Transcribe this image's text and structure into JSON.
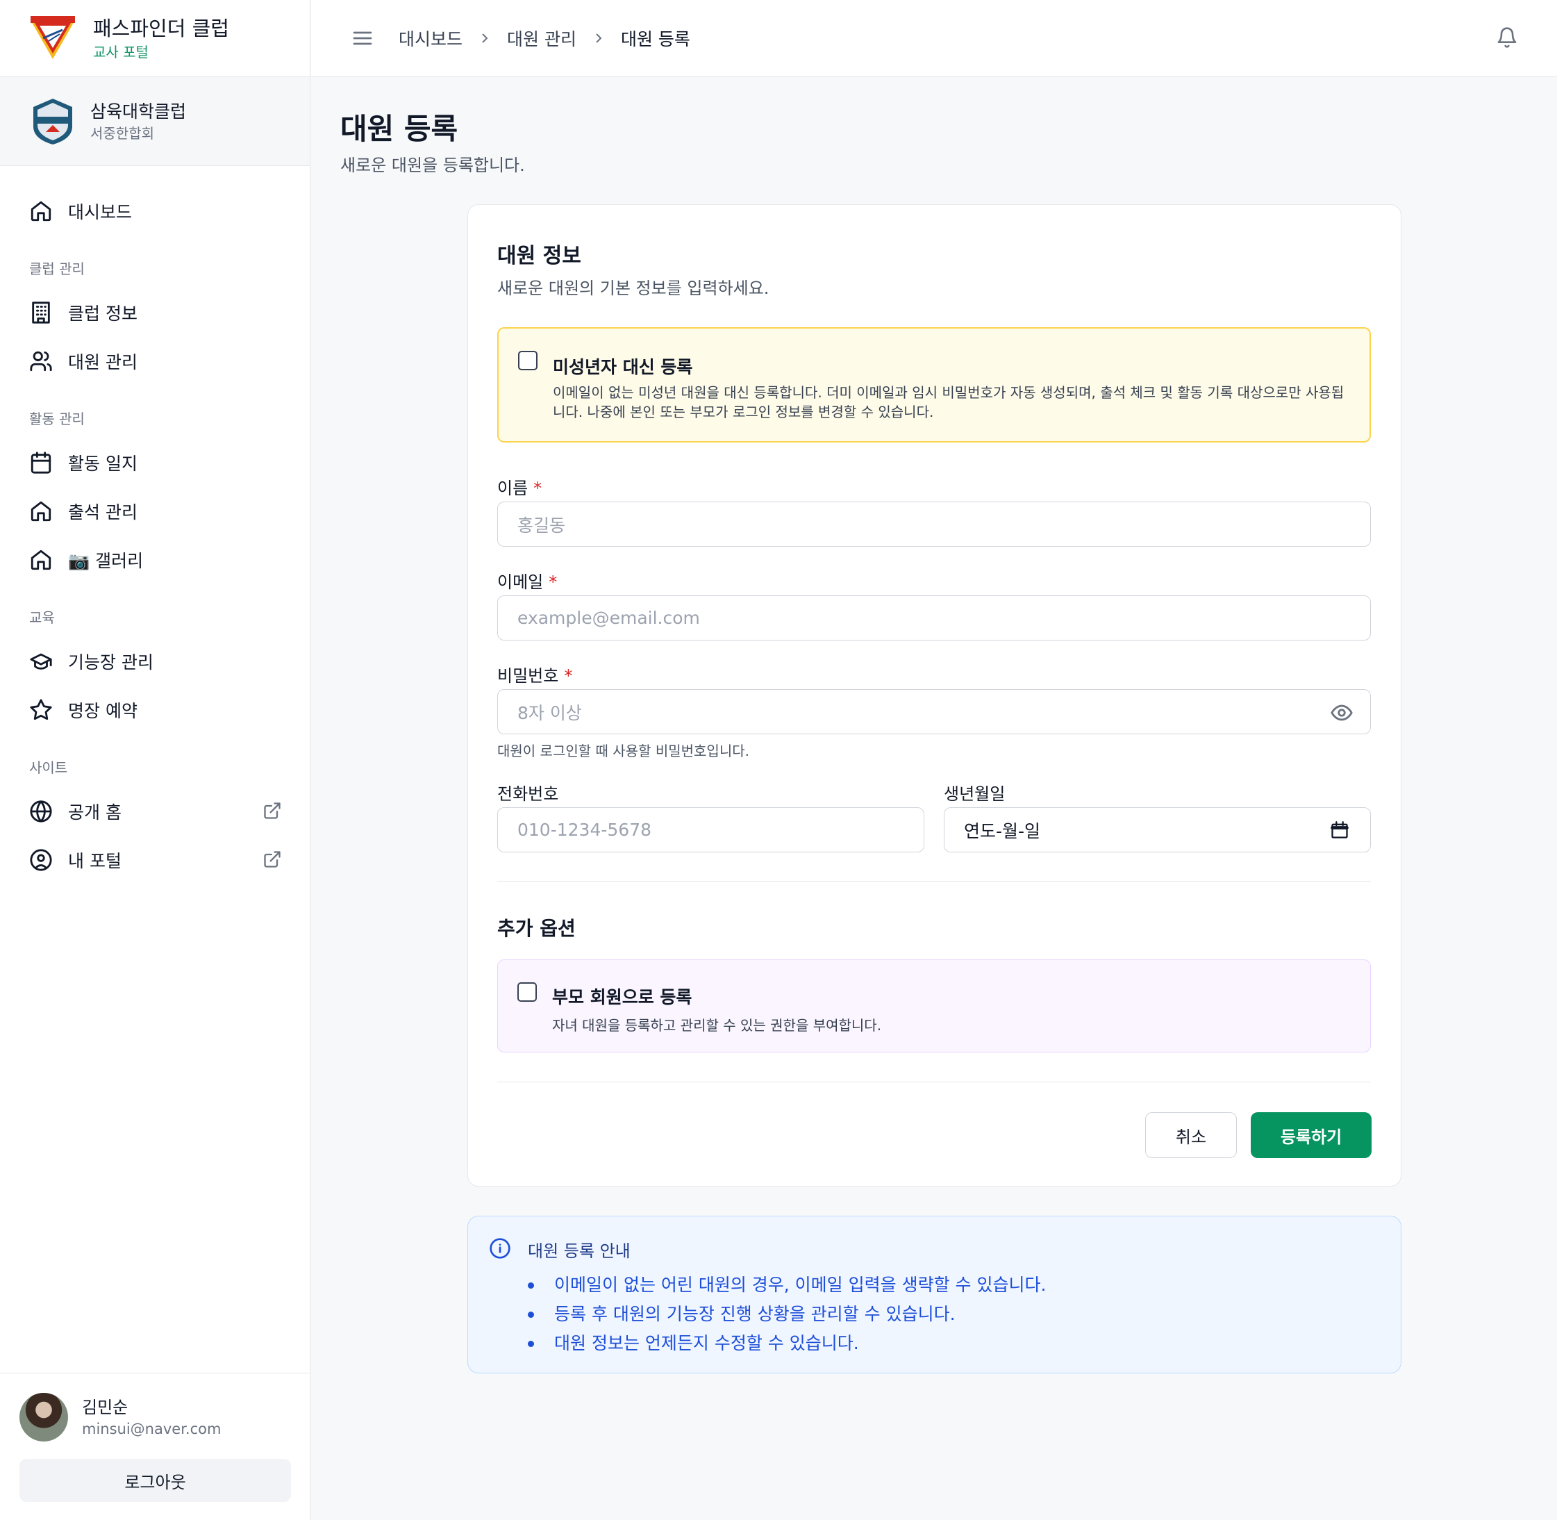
{
  "brand": {
    "title": "패스파인더 클럽",
    "subtitle": "교사 포털"
  },
  "club": {
    "name": "삼육대학클럽",
    "region": "서중한합회"
  },
  "sidebar": {
    "dashboard": "대시보드",
    "sections": [
      {
        "title": "클럽 관리",
        "items": [
          "클럽 정보",
          "대원 관리"
        ]
      },
      {
        "title": "활동 관리",
        "items": [
          "활동 일지",
          "출석 관리",
          "📷 갤러리"
        ]
      },
      {
        "title": "교육",
        "items": [
          "기능장 관리",
          "명장 예약"
        ]
      },
      {
        "title": "사이트",
        "items": [
          "공개 홈",
          "내 포털"
        ]
      }
    ]
  },
  "user": {
    "name": "김민순",
    "email": "minsui@naver.com",
    "logout": "로그아웃"
  },
  "breadcrumb": [
    "대시보드",
    "대원 관리",
    "대원 등록"
  ],
  "page": {
    "title": "대원 등록",
    "subtitle": "새로운 대원을 등록합니다."
  },
  "form": {
    "title": "대원 정보",
    "subtitle": "새로운 대원의 기본 정보를 입력하세요.",
    "minor": {
      "title": "미성년자 대신 등록",
      "desc": "이메일이 없는 미성년 대원을 대신 등록합니다. 더미 이메일과 임시 비밀번호가 자동 생성되며, 출석 체크 및 활동 기록 대상으로만 사용됩니다. 나중에 본인 또는 부모가 로그인 정보를 변경할 수 있습니다."
    },
    "name": {
      "label": "이름",
      "required": "*",
      "placeholder": "홍길동"
    },
    "email": {
      "label": "이메일",
      "required": "*",
      "placeholder": "example@email.com"
    },
    "password": {
      "label": "비밀번호",
      "required": "*",
      "placeholder": "8자 이상",
      "hint": "대원이 로그인할 때 사용할 비밀번호입니다."
    },
    "phone": {
      "label": "전화번호",
      "placeholder": "010-1234-5678"
    },
    "birth": {
      "label": "생년월일",
      "value": "연도-월-일"
    },
    "extra_title": "추가 옵션",
    "parent": {
      "title": "부모 회원으로 등록",
      "desc": "자녀 대원을 등록하고 관리할 수 있는 권한을 부여합니다."
    },
    "cancel": "취소",
    "submit": "등록하기"
  },
  "info": {
    "title": "대원 등록 안내",
    "items": [
      "이메일이 없는 어린 대원의 경우, 이메일 입력을 생략할 수 있습니다.",
      "등록 후 대원의 기능장 진행 상황을 관리할 수 있습니다.",
      "대원 정보는 언제든지 수정할 수 있습니다."
    ]
  },
  "colors": {
    "accent": "#069460",
    "warning_bg": "#fefbe8",
    "info_bg": "#eff6ff",
    "required": "#dc2626"
  }
}
